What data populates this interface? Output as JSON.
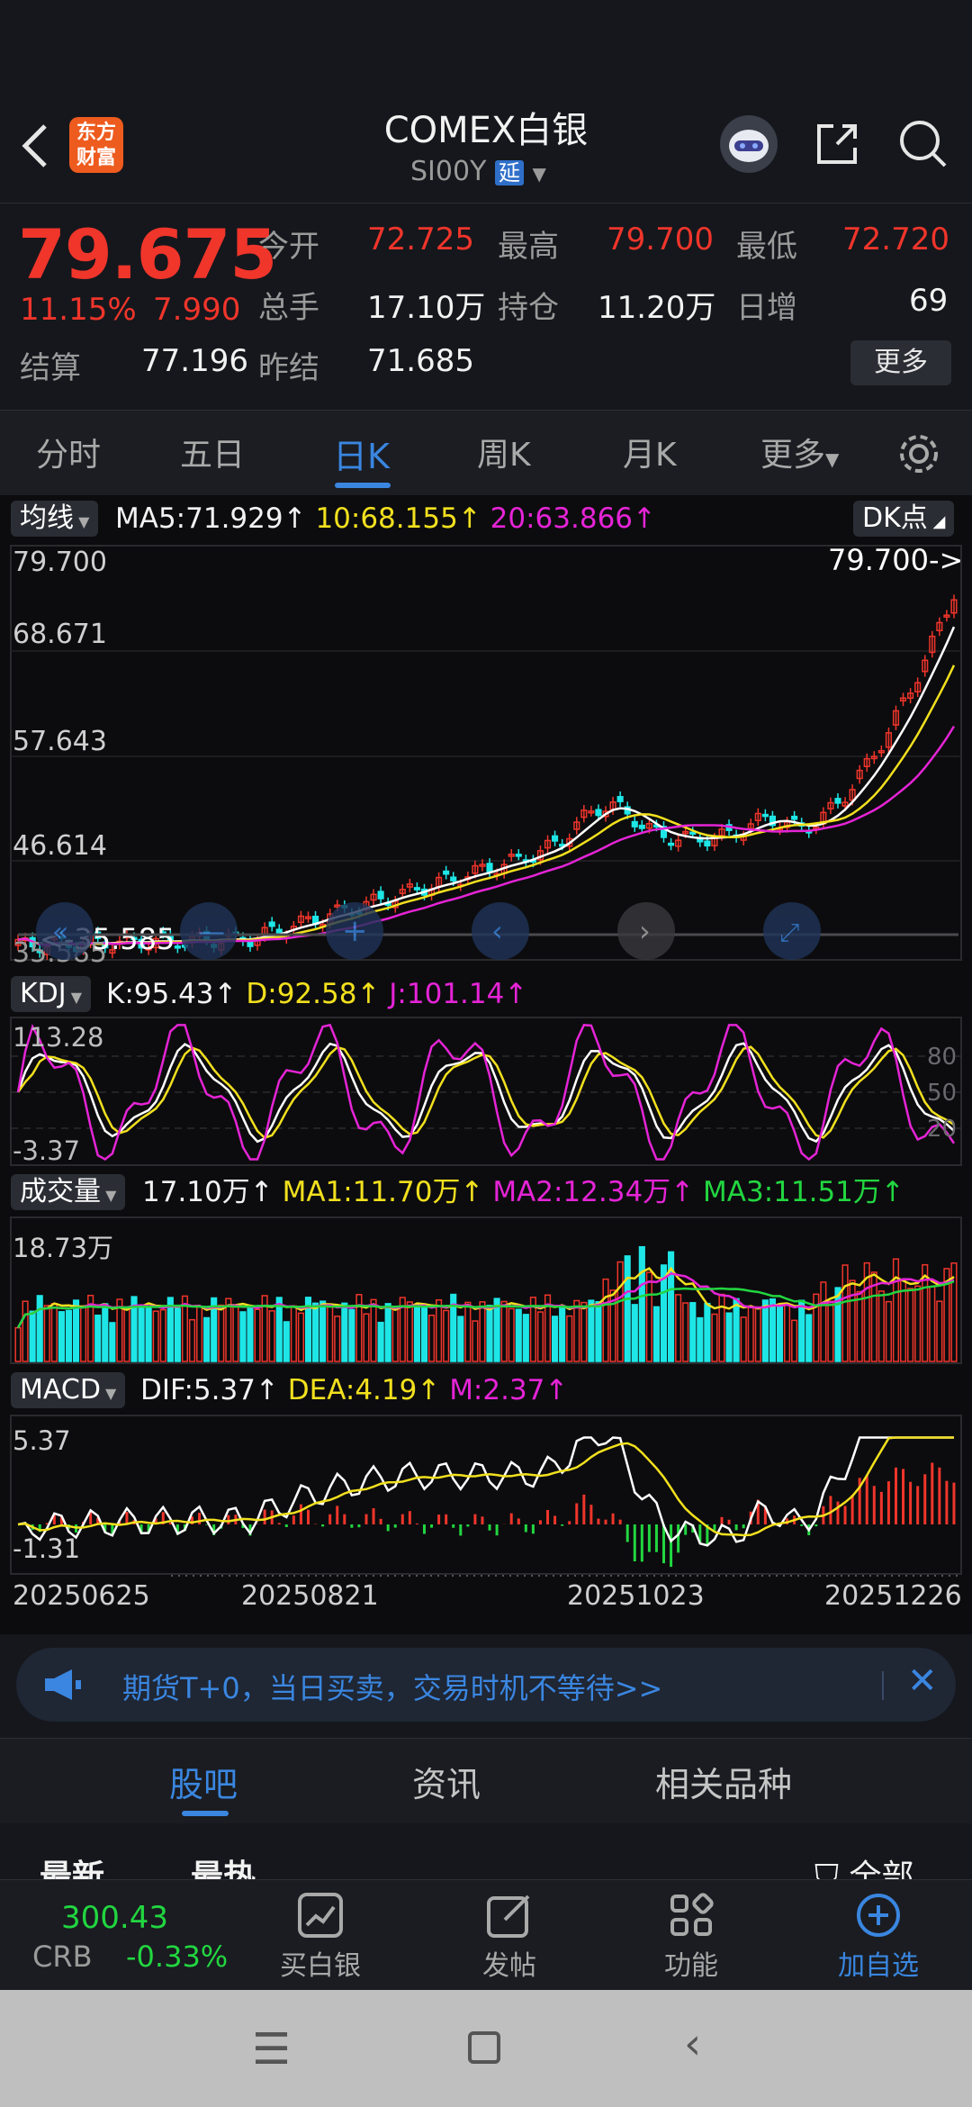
{
  "header": {
    "logo_text_1": "东方",
    "logo_text_2": "财富",
    "title": "COMEX白银",
    "symbol": "SI00Y",
    "delay_badge": "延"
  },
  "quote": {
    "price": "79.675",
    "change_pct": "11.15%",
    "change_abs": "7.990",
    "open_label": "今开",
    "open": "72.725",
    "high_label": "最高",
    "high": "79.700",
    "low_label": "最低",
    "low": "72.720",
    "volume_label": "总手",
    "volume": "17.10万",
    "oi_label": "持仓",
    "oi": "11.20万",
    "daily_inc_label": "日增",
    "daily_inc": "69",
    "settle_label": "结算",
    "settle": "77.196",
    "prev_settle_label": "昨结",
    "prev_settle": "71.685",
    "more_button": "更多"
  },
  "tabs": {
    "items": [
      "分时",
      "五日",
      "日K",
      "周K",
      "月K",
      "更多"
    ],
    "active": "日K"
  },
  "chart_data": [
    {
      "type": "candlestick",
      "title": "日K",
      "indicator_selector": "均线",
      "ma_labels": [
        "MA5:71.929",
        "10:68.155",
        "20:63.866"
      ],
      "dk_button": "DK点",
      "y_ticks": [
        "79.700",
        "68.671",
        "57.643",
        "46.614",
        "35.585"
      ],
      "last_price_marker": "79.700->",
      "low_marker": "<-35.585",
      "x_ticks": [
        "20250625",
        "20250821",
        "20251023",
        "20251226"
      ]
    },
    {
      "type": "line",
      "title": "KDJ",
      "values_labels": [
        "K:95.43",
        "D:92.58",
        "J:101.14"
      ],
      "y_ticks": [
        "113.28",
        "-3.37"
      ],
      "ref_levels": [
        "80",
        "50",
        "20"
      ]
    },
    {
      "type": "bar",
      "title": "成交量",
      "values_labels": [
        "17.10万",
        "MA1:11.70万",
        "MA2:12.34万",
        "MA3:11.51万"
      ],
      "y_ticks": [
        "18.73万"
      ]
    },
    {
      "type": "bar",
      "title": "MACD",
      "values_labels": [
        "DIF:5.37",
        "DEA:4.19",
        "M:2.37"
      ],
      "y_ticks": [
        "5.37",
        "-1.31"
      ]
    }
  ],
  "promo": {
    "text": "期货T+0，当日买卖，交易时机不等待>>"
  },
  "bottom_tabs": {
    "items": [
      "股吧",
      "资讯",
      "相关品种"
    ],
    "sub_items": [
      "最新",
      "最热",
      "全部"
    ]
  },
  "bottom_bar": {
    "crb_value": "300.43",
    "crb_label": "CRB",
    "crb_change": "-0.33%",
    "actions": [
      "买白银",
      "发帖",
      "功能",
      "加自选"
    ]
  },
  "colors": {
    "up": "#f0352b",
    "down": "#1fe6e6",
    "ma5": "#ffffff",
    "ma10": "#f2e01e",
    "ma20": "#e524d6",
    "accent": "#3a86e0"
  }
}
